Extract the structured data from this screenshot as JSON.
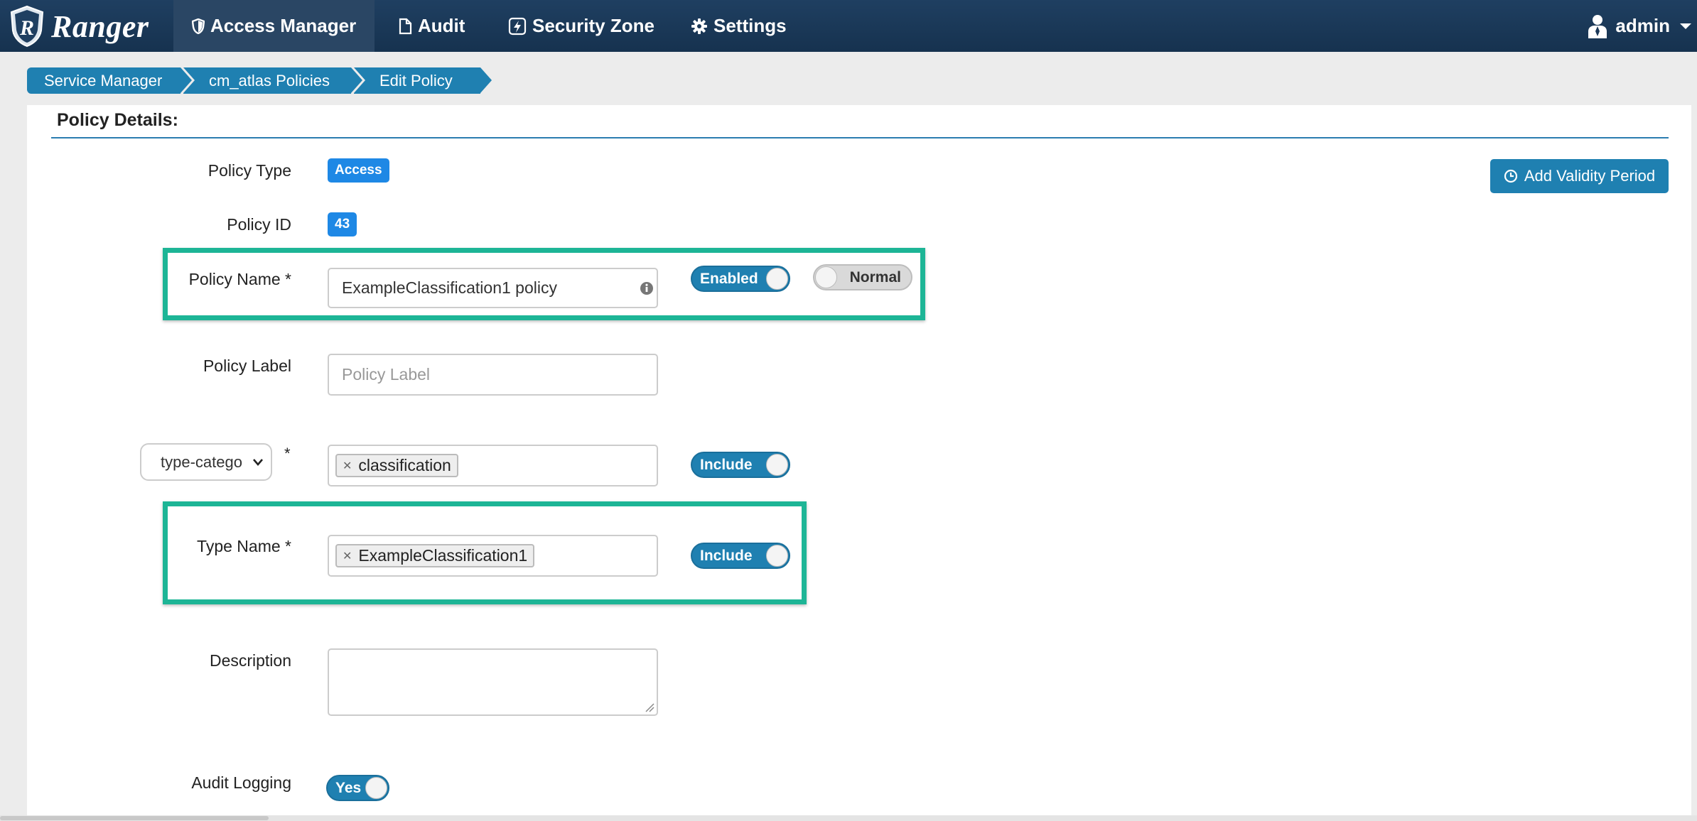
{
  "nav": {
    "brand": "Ranger",
    "items": [
      {
        "label": "Access Manager",
        "icon": "shield-icon",
        "active": true
      },
      {
        "label": "Audit",
        "icon": "document-icon",
        "active": false
      },
      {
        "label": "Security Zone",
        "icon": "lightning-icon",
        "active": false
      },
      {
        "label": "Settings",
        "icon": "gear-icon",
        "active": false
      }
    ],
    "user": "admin",
    "user_icon": "user-icon"
  },
  "breadcrumb": [
    "Service Manager",
    "cm_atlas Policies",
    "Edit Policy"
  ],
  "form": {
    "section_title": "Policy Details:",
    "add_validity_label": "Add Validity Period",
    "policy_type_label": "Policy Type",
    "policy_type_value": "Access",
    "policy_id_label": "Policy ID",
    "policy_id_value": "43",
    "policy_name_label": "Policy Name *",
    "policy_name_value": "ExampleClassification1 policy",
    "enabled_label": "Enabled",
    "normal_label": "Normal",
    "policy_label_label": "Policy Label",
    "policy_label_placeholder": "Policy Label",
    "resource_select_value": "type-catego",
    "resource_required_mark": "*",
    "resource_tag": "classification",
    "resource_include_label": "Include",
    "type_name_label": "Type Name *",
    "type_name_tag": "ExampleClassification1",
    "type_name_include_label": "Include",
    "description_label": "Description",
    "audit_logging_label": "Audit Logging",
    "audit_logging_value": "Yes"
  },
  "colors": {
    "navbar": "#1f3f61",
    "accent": "#1f80b1",
    "badge": "#1e88e5",
    "highlight": "#1db596"
  }
}
